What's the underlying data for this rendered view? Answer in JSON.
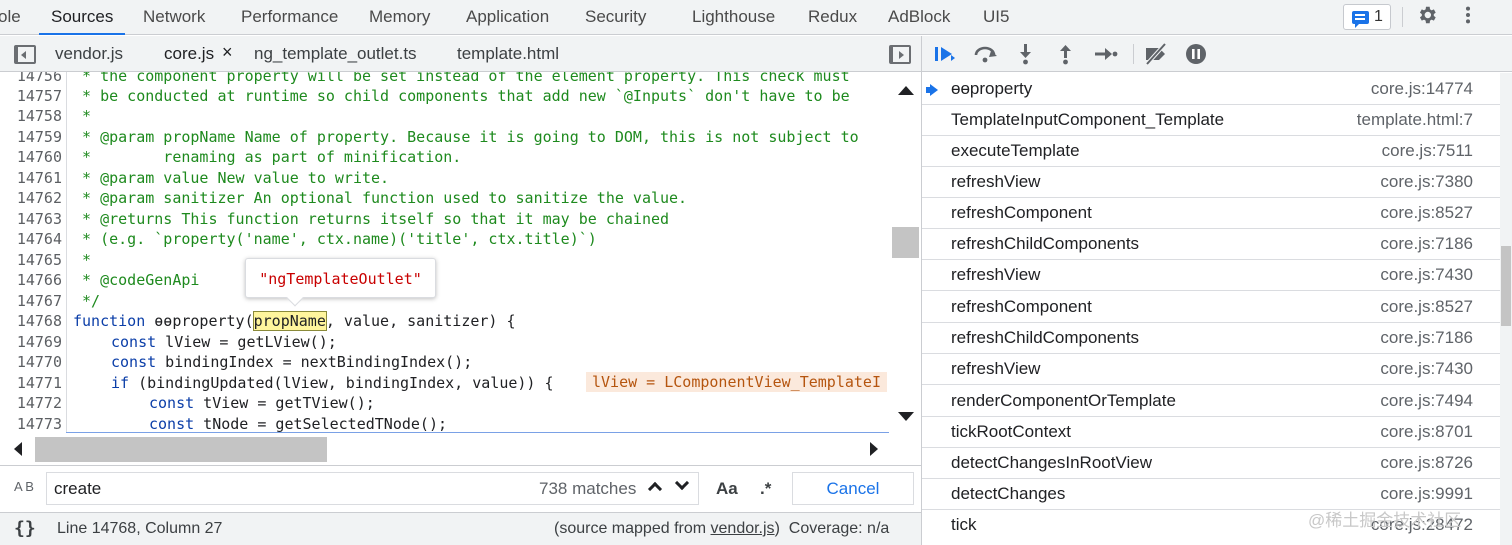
{
  "top_tabs": [
    {
      "label": "ole"
    },
    {
      "label": "Sources"
    },
    {
      "label": "Network"
    },
    {
      "label": "Performance"
    },
    {
      "label": "Memory"
    },
    {
      "label": "Application"
    },
    {
      "label": "Security"
    },
    {
      "label": "Lighthouse"
    },
    {
      "label": "Redux"
    },
    {
      "label": "AdBlock"
    },
    {
      "label": "UI5"
    }
  ],
  "issues_count": "1",
  "editor_tabs": [
    {
      "label": "vendor.js"
    },
    {
      "label": "core.js"
    },
    {
      "label": "ng_template_outlet.ts"
    },
    {
      "label": "template.html"
    }
  ],
  "close_glyph": "×",
  "code_lines": [
    {
      "num": "14756",
      "text": " * the component property will be set instead of the element property. This check must"
    },
    {
      "num": "14757",
      "text": " * be conducted at runtime so child components that add new `@Inputs` don't have to be"
    },
    {
      "num": "14758",
      "text": " *"
    },
    {
      "num": "14759",
      "text": " * @param propName Name of property. Because it is going to DOM, this is not subject to"
    },
    {
      "num": "14760",
      "text": " *        renaming as part of minification."
    },
    {
      "num": "14761",
      "text": " * @param value New value to write."
    },
    {
      "num": "14762",
      "text": " * @param sanitizer An optional function used to sanitize the value."
    },
    {
      "num": "14763",
      "text": " * @returns This function returns itself so that it may be chained"
    },
    {
      "num": "14764",
      "text": " * (e.g. `property('name', ctx.name)('title', ctx.title)`)"
    },
    {
      "num": "14765",
      "text": " *"
    },
    {
      "num": "14766",
      "text": " * @codeGenApi"
    },
    {
      "num": "14767",
      "text": " */"
    },
    {
      "num": "14768",
      "text": ""
    },
    {
      "num": "14769",
      "text": ""
    },
    {
      "num": "14770",
      "text": ""
    },
    {
      "num": "14771",
      "text": ""
    },
    {
      "num": "14772",
      "text": ""
    },
    {
      "num": "14773",
      "text": ""
    }
  ],
  "code": {
    "l14768": {
      "kw": "function",
      "pre": " ɵɵproperty(",
      "param": "propName",
      "post": ", value, sanitizer) {"
    },
    "l14769": {
      "kw": "const",
      "rest": " lView = getLView();"
    },
    "l14770": {
      "kw": "const",
      "rest": " bindingIndex = nextBindingIndex();"
    },
    "l14771": {
      "kw": "if",
      "rest": " (bindingUpdated(lView, bindingIndex, value)) {"
    },
    "l14772": {
      "kw": "const",
      "rest": " tView = getTView();"
    },
    "l14773": {
      "kw": "const",
      "rest": " tNode = getSelectedTNode();"
    }
  },
  "inline_value": "lView = LComponentView_TemplateI",
  "tooltip": "\"ngTemplateOutlet\"",
  "search": {
    "value": "create",
    "matches": "738 matches",
    "case_label": "Aa",
    "regex_label": ".*",
    "cancel_label": "Cancel",
    "case_icon": "A B"
  },
  "status": {
    "braces": "{}",
    "cursor": "Line 14768, Column 27",
    "source_prefix": "(source mapped from ",
    "source_link": "vendor.js",
    "source_suffix": ")  Coverage: n/a"
  },
  "call_stack": [
    {
      "name": "ɵɵproperty",
      "loc": "core.js:14774",
      "current": true
    },
    {
      "name": "TemplateInputComponent_Template",
      "loc": "template.html:7"
    },
    {
      "name": "executeTemplate",
      "loc": "core.js:7511"
    },
    {
      "name": "refreshView",
      "loc": "core.js:7380"
    },
    {
      "name": "refreshComponent",
      "loc": "core.js:8527"
    },
    {
      "name": "refreshChildComponents",
      "loc": "core.js:7186"
    },
    {
      "name": "refreshView",
      "loc": "core.js:7430"
    },
    {
      "name": "refreshComponent",
      "loc": "core.js:8527"
    },
    {
      "name": "refreshChildComponents",
      "loc": "core.js:7186"
    },
    {
      "name": "refreshView",
      "loc": "core.js:7430"
    },
    {
      "name": "renderComponentOrTemplate",
      "loc": "core.js:7494"
    },
    {
      "name": "tickRootContext",
      "loc": "core.js:8701"
    },
    {
      "name": "detectChangesInRootView",
      "loc": "core.js:8726"
    },
    {
      "name": "detectChanges",
      "loc": "core.js:9991"
    },
    {
      "name": "tick",
      "loc": "core.js:28472"
    }
  ],
  "watermark": "@稀土掘金技术社区",
  "colors": {
    "accent": "#1a73e8",
    "comment": "#1e8a1e",
    "keyword": "#0b3ea8",
    "string": "#c80000"
  }
}
